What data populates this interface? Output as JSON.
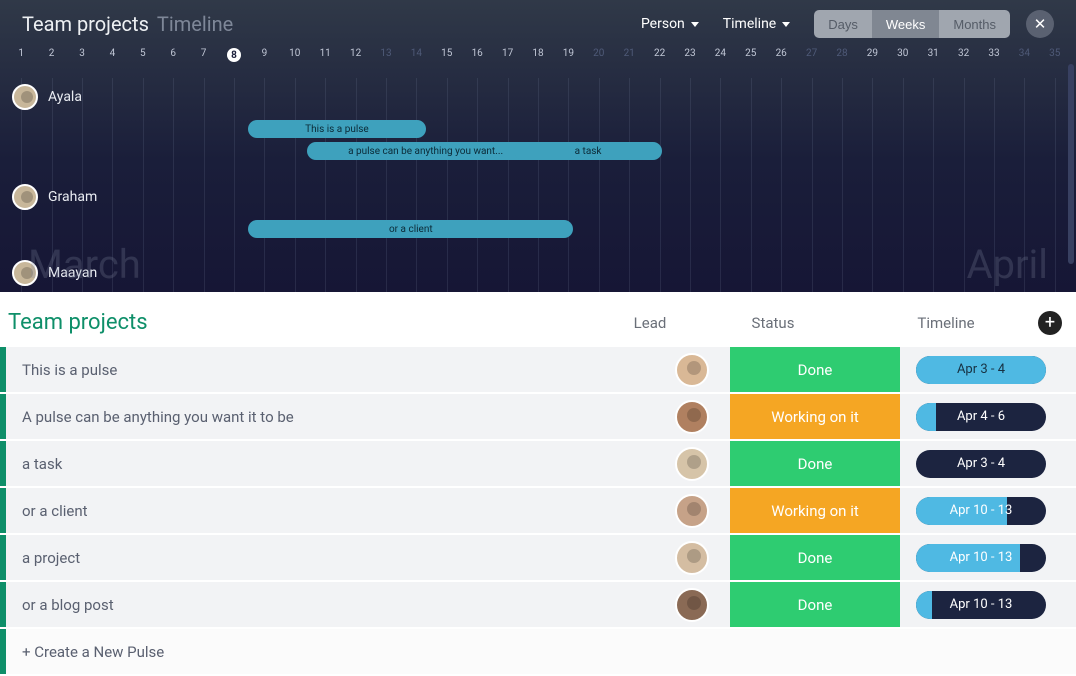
{
  "header": {
    "title": "Team projects",
    "subtitle": "Timeline",
    "person_dropdown": "Person",
    "view_dropdown": "Timeline",
    "scale": {
      "days": "Days",
      "weeks": "Weeks",
      "months": "Months",
      "active": "Weeks"
    }
  },
  "timeline": {
    "ticks": [
      1,
      2,
      3,
      4,
      5,
      6,
      7,
      8,
      9,
      10,
      11,
      12,
      13,
      14,
      15,
      16,
      17,
      18,
      19,
      20,
      21,
      22,
      23,
      24,
      25,
      26,
      27,
      28,
      29,
      30,
      31,
      32,
      33,
      34,
      35
    ],
    "today": 8,
    "faded_days": [
      13,
      14,
      20,
      21,
      27,
      28,
      34,
      35
    ],
    "month_left": "March",
    "month_right": "April",
    "people": [
      {
        "name": "Ayala"
      },
      {
        "name": "Graham"
      },
      {
        "name": "Maayan"
      }
    ],
    "bars": [
      {
        "label": "This is a pulse",
        "start": 9,
        "end": 14,
        "row": 0
      },
      {
        "label": "a pulse can be anything you want...",
        "start": 11,
        "end": 18,
        "row": 1
      },
      {
        "label": "a task",
        "start": 18,
        "end": 22,
        "row": 1
      },
      {
        "label": "or a client",
        "start": 9,
        "end": 19,
        "row": 2
      }
    ]
  },
  "table": {
    "title": "Team projects",
    "columns": {
      "lead": "Lead",
      "status": "Status",
      "timeline": "Timeline"
    },
    "create_label": "+ Create a New Pulse",
    "rows": [
      {
        "text": "This is a pulse",
        "status": "Done",
        "status_type": "done",
        "timeline": "Apr 3 - 4",
        "fill": 100
      },
      {
        "text": "A pulse can be anything you want it to be",
        "status": "Working on it",
        "status_type": "working",
        "timeline": "Apr 4 - 6",
        "fill": 15
      },
      {
        "text": "a task",
        "status": "Done",
        "status_type": "done",
        "timeline": "Apr 3 - 4",
        "fill": 0
      },
      {
        "text": "or a client",
        "status": "Working on it",
        "status_type": "working",
        "timeline": "Apr 10 - 13",
        "fill": 70
      },
      {
        "text": "a project",
        "status": "Done",
        "status_type": "done",
        "timeline": "Apr 10 - 13",
        "fill": 80
      },
      {
        "text": "or a blog post",
        "status": "Done",
        "status_type": "done",
        "timeline": "Apr 10 - 13",
        "fill": 12
      }
    ]
  }
}
